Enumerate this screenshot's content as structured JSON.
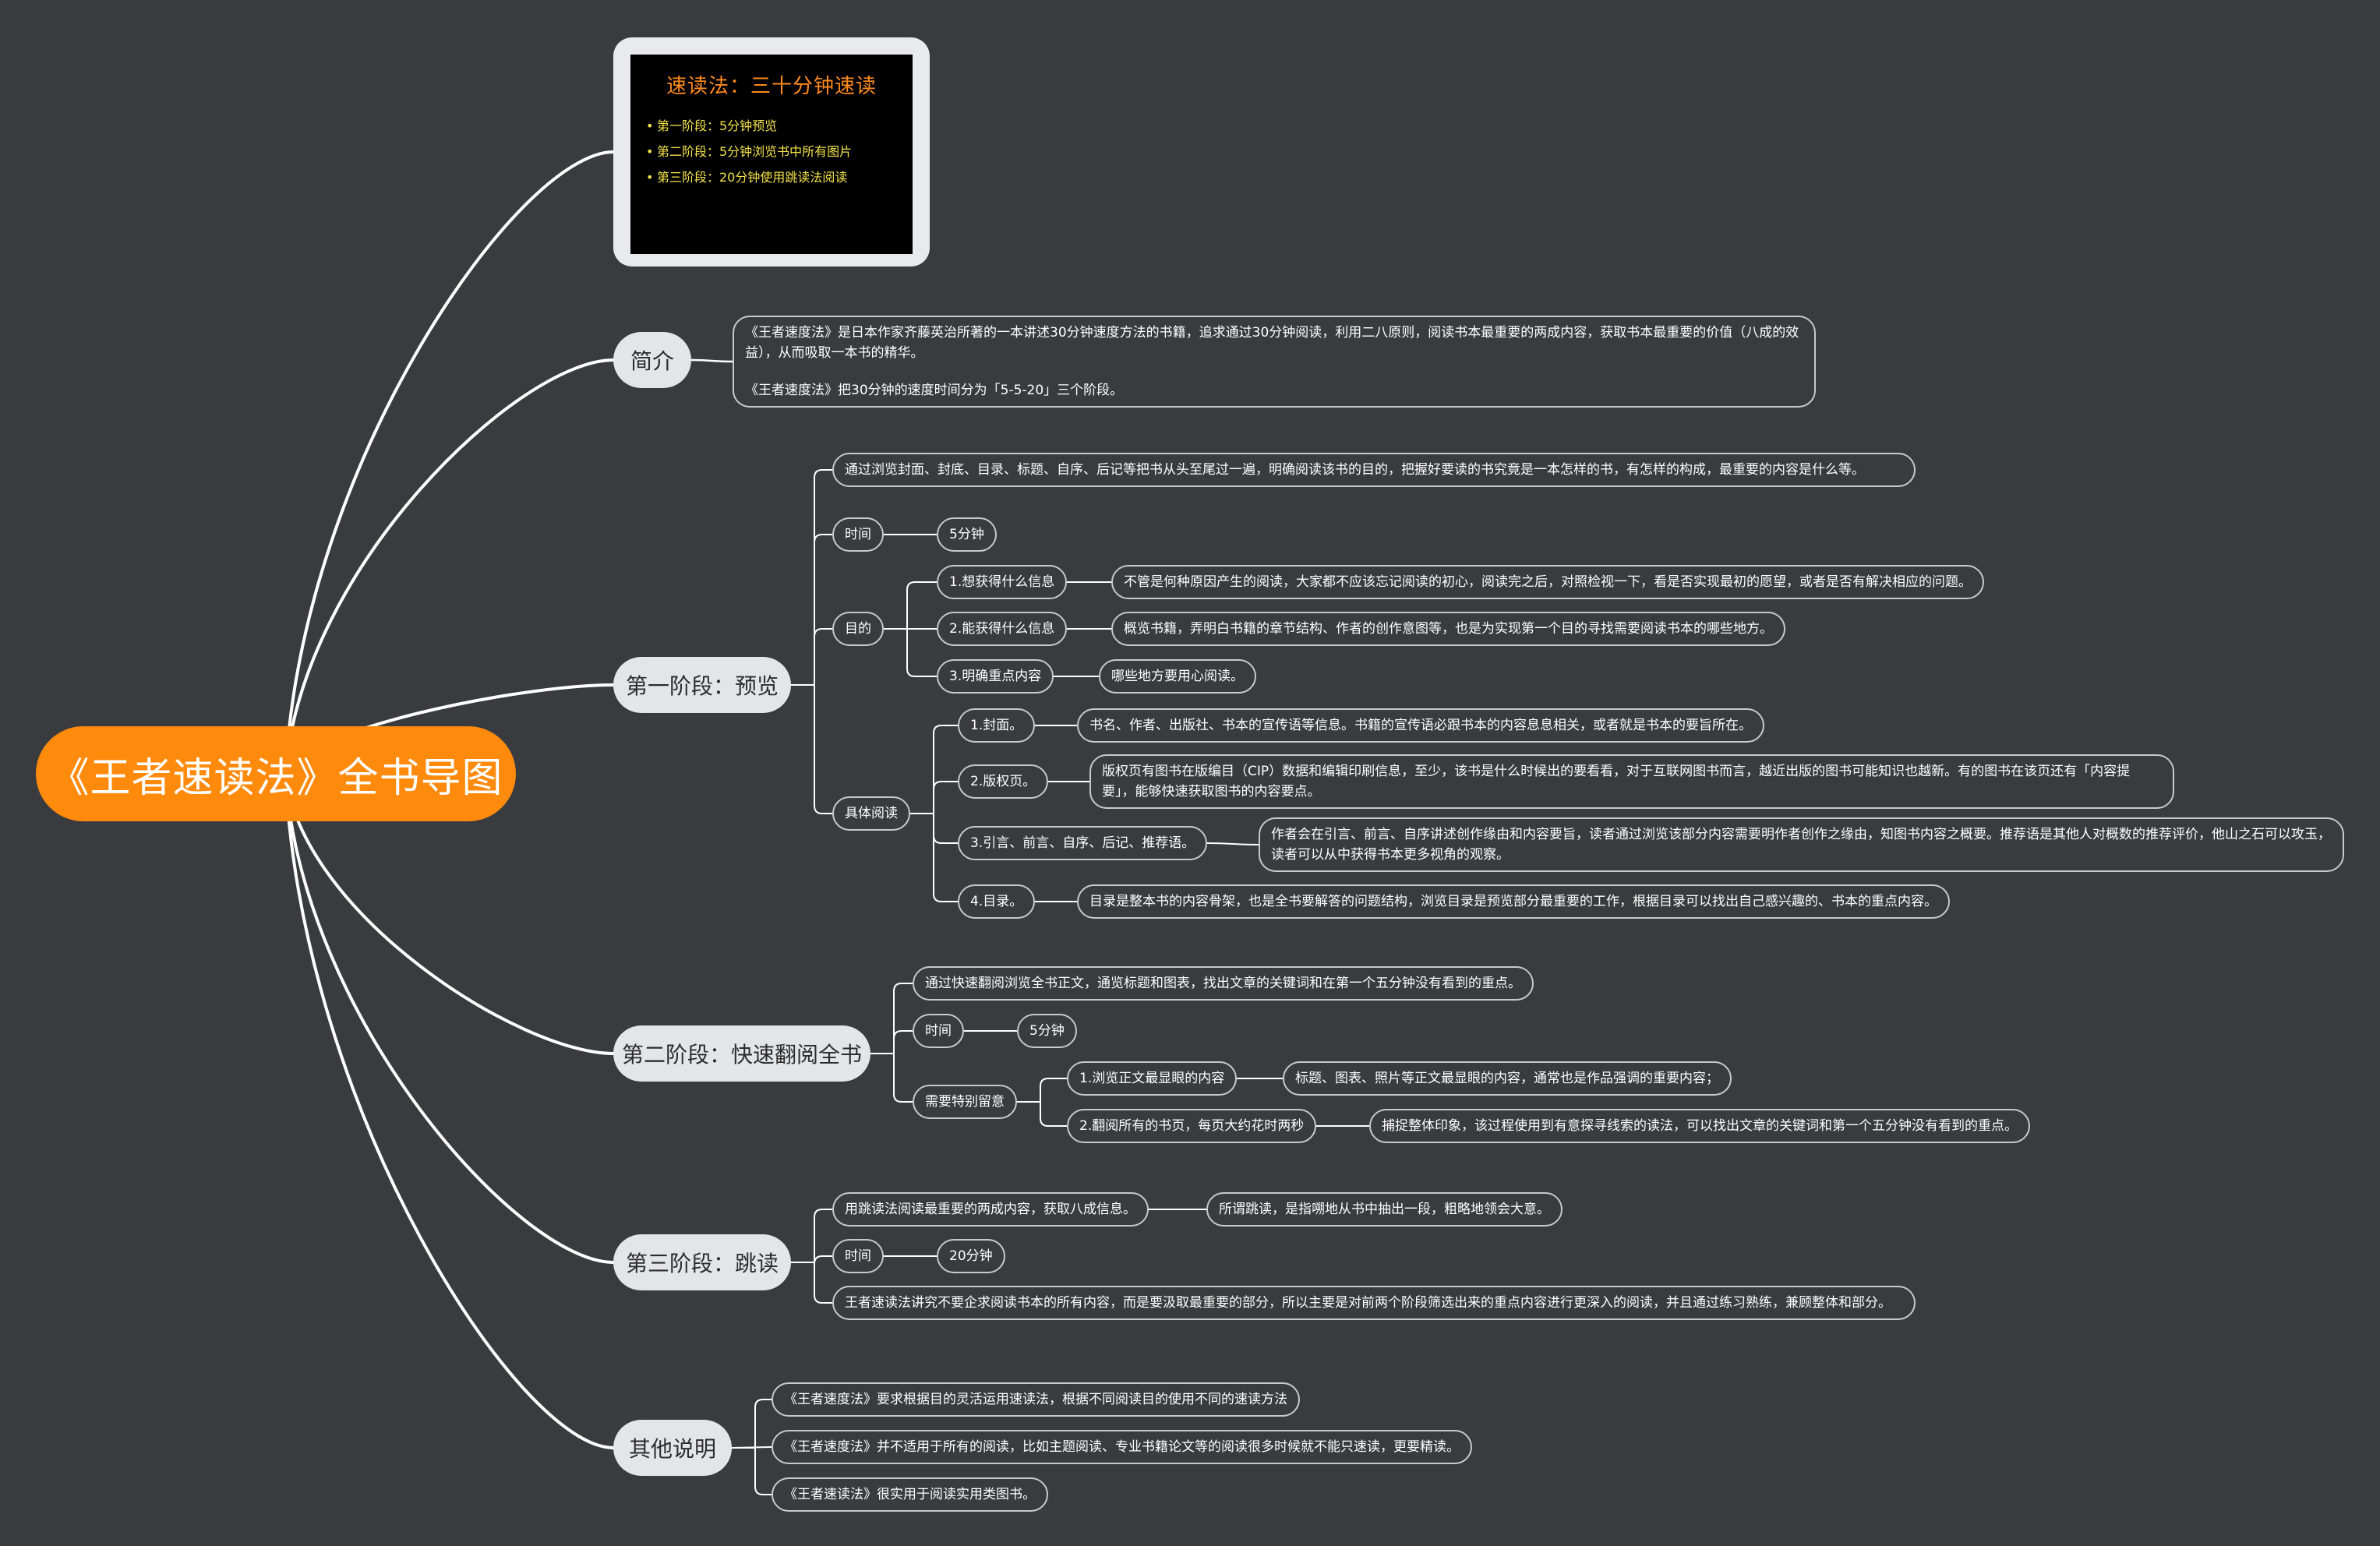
{
  "root": "《王者速读法》全书导图",
  "image_card": {
    "title": "速读法：三十分钟速读",
    "items": [
      "第一阶段：5分钟预览",
      "第二阶段：5分钟浏览书中所有图片",
      "第三阶段：20分钟使用跳读法阅读"
    ]
  },
  "intro": {
    "label": "简介",
    "text1": "《王者速度法》是日本作家齐藤英治所著的一本讲述30分钟速度方法的书籍，追求通过30分钟阅读，利用二八原则，阅读书本最重要的两成内容，获取书本最重要的价值（八成的效益），从而吸取一本书的精华。",
    "text2": "《王者速度法》把30分钟的速度时间分为「5-5-20」三个阶段。"
  },
  "stage1": {
    "label": "第一阶段：预览",
    "desc": "通过浏览封面、封底、目录、标题、自序、后记等把书从头至尾过一遍，明确阅读该书的目的，把握好要读的书究竟是一本怎样的书，有怎样的构成，最重要的内容是什么等。",
    "time_label": "时间",
    "time_value": "5分钟",
    "purpose_label": "目的",
    "purposes": [
      {
        "title": "1.想获得什么信息",
        "detail": "不管是何种原因产生的阅读，大家都不应该忘记阅读的初心，阅读完之后，对照检视一下，看是否实现最初的愿望，或者是否有解决相应的问题。"
      },
      {
        "title": "2.能获得什么信息",
        "detail": "概览书籍，弄明白书籍的章节结构、作者的创作意图等，也是为实现第一个目的寻找需要阅读书本的哪些地方。"
      },
      {
        "title": "3.明确重点内容",
        "detail": "哪些地方要用心阅读。"
      }
    ],
    "detail_label": "具体阅读",
    "details": [
      {
        "title": "1.封面。",
        "detail": "书名、作者、出版社、书本的宣传语等信息。书籍的宣传语必跟书本的内容息息相关，或者就是书本的要旨所在。"
      },
      {
        "title": "2.版权页。",
        "detail": "版权页有图书在版编目（CIP）数据和编辑印刷信息，至少，该书是什么时候出的要看看，对于互联网图书而言，越近出版的图书可能知识也越新。有的图书在该页还有「内容提要」，能够快速获取图书的内容要点。"
      },
      {
        "title": "3.引言、前言、自序、后记、推荐语。",
        "detail": "作者会在引言、前言、自序讲述创作缘由和内容要旨，读者通过浏览该部分内容需要明作者创作之缘由，知图书内容之概要。推荐语是其他人对概数的推荐评价，他山之石可以攻玉，读者可以从中获得书本更多视角的观察。"
      },
      {
        "title": "4.目录。",
        "detail": "目录是整本书的内容骨架，也是全书要解答的问题结构，浏览目录是预览部分最重要的工作，根据目录可以找出自己感兴趣的、书本的重点内容。"
      }
    ]
  },
  "stage2": {
    "label": "第二阶段：快速翻阅全书",
    "desc": "通过快速翻阅浏览全书正文，通览标题和图表，找出文章的关键词和在第一个五分钟没有看到的重点。",
    "time_label": "时间",
    "time_value": "5分钟",
    "notice_label": "需要特别留意",
    "notices": [
      {
        "title": "1.浏览正文最显眼的内容",
        "detail": "标题、图表、照片等正文最显眼的内容，通常也是作品强调的重要内容；"
      },
      {
        "title": "2.翻阅所有的书页，每页大约花时两秒",
        "detail": "捕捉整体印象，该过程使用到有意探寻线索的读法，可以找出文章的关键词和第一个五分钟没有看到的重点。"
      }
    ]
  },
  "stage3": {
    "label": "第三阶段：跳读",
    "desc": "用跳读法阅读最重要的两成内容，获取八成信息。",
    "desc_detail": "所谓跳读，是指嗍地从书中抽出一段，粗略地领会大意。",
    "time_label": "时间",
    "time_value": "20分钟",
    "note": "王者速读法讲究不要企求阅读书本的所有内容，而是要汲取最重要的部分，所以主要是对前两个阶段筛选出来的重点内容进行更深入的阅读，并且通过练习熟练，兼顾整体和部分。"
  },
  "other": {
    "label": "其他说明",
    "items": [
      "《王者速度法》要求根据目的灵活运用速读法，根据不同阅读目的使用不同的速读方法",
      "《王者速度法》并不适用于所有的阅读，比如主题阅读、专业书籍论文等的阅读很多时候就不能只速读，更要精读。",
      "《王者速读法》很实用于阅读实用类图书。"
    ]
  },
  "colors": {
    "background": "#3a3b3f",
    "root": "#ff8a0c",
    "branch": "#e4e5e7",
    "connector": "#ffffff",
    "image_title": "#ff8a1e",
    "image_items": "#f4e34a"
  }
}
